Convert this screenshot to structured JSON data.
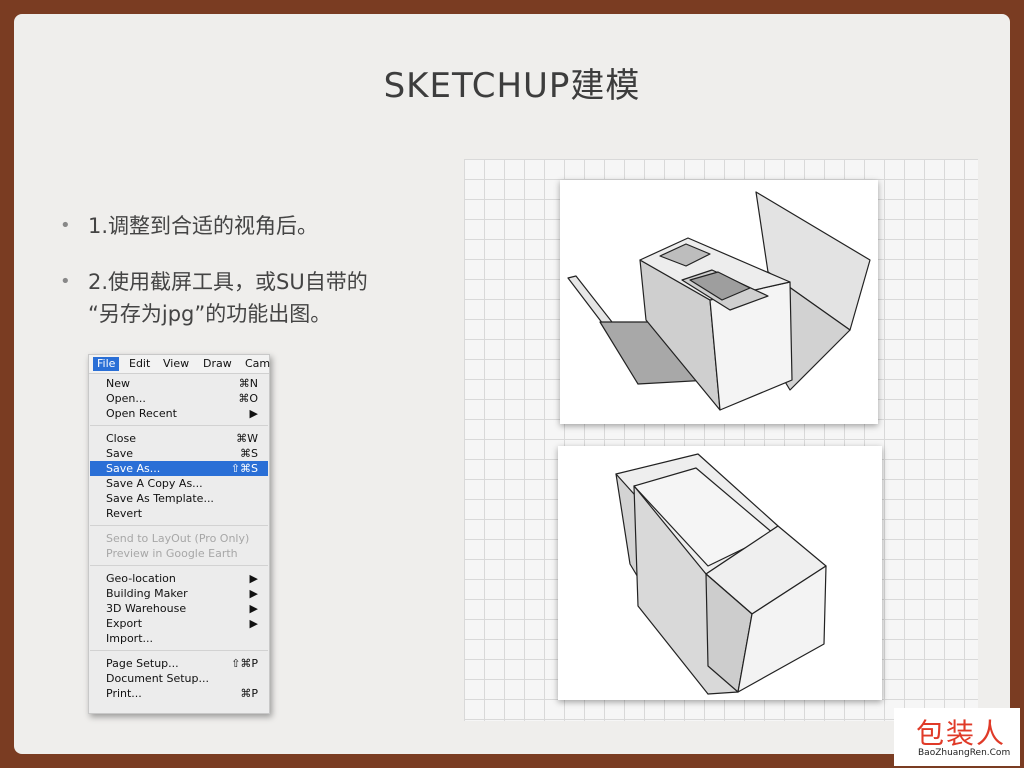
{
  "slide": {
    "title": "SKETCHUP建模",
    "bullets": [
      {
        "text": "1.调整到合适的视角后。"
      },
      {
        "text_line1": "2.使用截屏工具，或SU自带的",
        "text_line2": "“另存为jpg”的功能出图。"
      }
    ],
    "bullet_symbol": "•"
  },
  "menu": {
    "bar": [
      "File",
      "Edit",
      "View",
      "Draw",
      "Cam"
    ],
    "items": [
      {
        "label": "New",
        "shortcut": "⌘N"
      },
      {
        "label": "Open...",
        "shortcut": "⌘O"
      },
      {
        "label": "Open Recent",
        "shortcut": "▶"
      },
      {
        "label": "Close",
        "shortcut": "⌘W"
      },
      {
        "label": "Save",
        "shortcut": "⌘S"
      },
      {
        "label": "Save As...",
        "shortcut": "⇧⌘S"
      },
      {
        "label": "Save A Copy As...",
        "shortcut": ""
      },
      {
        "label": "Save As Template...",
        "shortcut": ""
      },
      {
        "label": "Revert",
        "shortcut": ""
      },
      {
        "label": "Send to LayOut (Pro Only)",
        "shortcut": ""
      },
      {
        "label": "Preview in Google Earth",
        "shortcut": ""
      },
      {
        "label": "Geo-location",
        "shortcut": "▶"
      },
      {
        "label": "Building Maker",
        "shortcut": "▶"
      },
      {
        "label": "3D Warehouse",
        "shortcut": "▶"
      },
      {
        "label": "Export",
        "shortcut": "▶"
      },
      {
        "label": "Import...",
        "shortcut": ""
      },
      {
        "label": "Page Setup...",
        "shortcut": "⇧⌘P"
      },
      {
        "label": "Document Setup...",
        "shortcut": ""
      },
      {
        "label": "Print...",
        "shortcut": "⌘P"
      }
    ]
  },
  "logo": {
    "cn": "包装人",
    "en": "BaoZhuangRen.Com"
  },
  "colors": {
    "frame": "#7a3c22",
    "slide": "#efeeec",
    "menu_highlight": "#2a6fd6",
    "logo_red": "#e03a28"
  }
}
